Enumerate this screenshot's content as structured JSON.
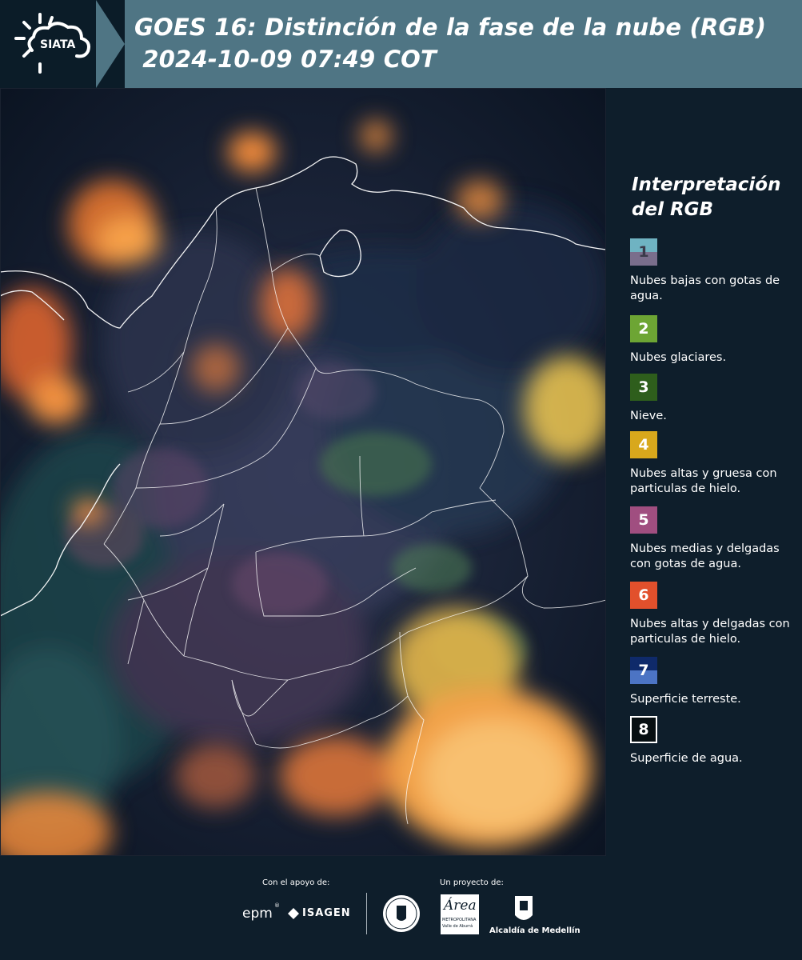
{
  "header": {
    "logo_text": "SIATA",
    "title_line1": "GOES 16: Distinción de la fase de la nube (RGB)",
    "title_line2": " 2024-10-09 07:49 COT"
  },
  "legend": {
    "title": "Interpretación del RGB",
    "items": [
      {
        "number": "1",
        "label": "Nubes bajas con gotas de agua.",
        "color_top": "#6fb3c2",
        "color_bottom": "#7a6e8c"
      },
      {
        "number": "2",
        "label": "Nubes glaciares.",
        "color": "#6da534"
      },
      {
        "number": "3",
        "label": "Nieve.",
        "color": "#2e5e1c"
      },
      {
        "number": "4",
        "label": "Nubes altas y gruesa con particulas de hielo.",
        "color": "#d8a81c"
      },
      {
        "number": "5",
        "label": "Nubes medias y delgadas con gotas de agua.",
        "color": "#a04e80"
      },
      {
        "number": "6",
        "label": "Nubes altas y delgadas con particulas de hielo.",
        "color": "#e2502c"
      },
      {
        "number": "7",
        "label": "Superficie terreste.",
        "color_top": "#0f2a6a",
        "color_bottom": "#4c74c4"
      },
      {
        "number": "8",
        "label": "Superficie de agua.",
        "color": "#070f12"
      }
    ]
  },
  "footer": {
    "support_label": "Con el apoyo de:",
    "project_label": "Un proyecto de:",
    "sponsor_epm": "epm",
    "sponsor_isagen": "ISAGEN",
    "partner_area_metro": "Área",
    "partner_area_sub": "METROPOLITANA",
    "partner_area_sub2": "Valle de Aburrá",
    "partner_alcaldia": "Alcaldía de Medellín"
  },
  "colors": {
    "header_band": "#4f7584",
    "background": "#0e1e2b",
    "cloud_orange": "#f29a3a",
    "cloud_yellow": "#e6c24a",
    "border_white": "#ffffff"
  }
}
